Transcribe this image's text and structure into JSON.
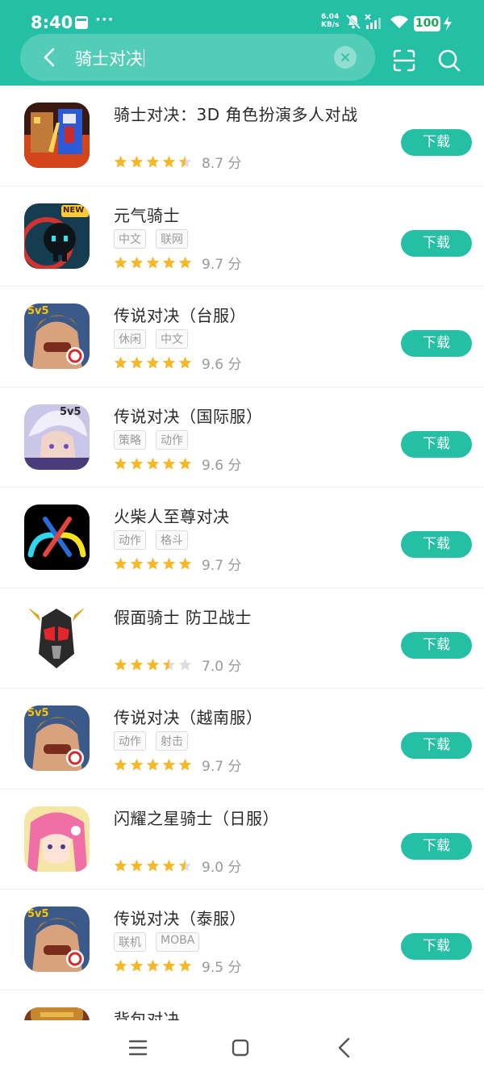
{
  "status_bar": {
    "time": "8:40",
    "dots": "···",
    "speed_value": "6.04",
    "speed_unit": "KB/s",
    "battery": "100"
  },
  "search": {
    "query": "骑士对决",
    "clear_label": "×"
  },
  "colors": {
    "accent": "#25bfa5",
    "star": "#f6b826",
    "star_empty": "#dddddd"
  },
  "apps": [
    {
      "name": "骑士对决：3D 角色扮演多人对战",
      "tags": [],
      "rating": 4.5,
      "score": "8.7 分",
      "button": "下载",
      "icon": "knight-duel-icon"
    },
    {
      "name": "元气骑士",
      "tags": [
        "中文",
        "联网"
      ],
      "rating": 5,
      "score": "9.7 分",
      "button": "下载",
      "icon": "soul-knight-icon",
      "badge": "NEW"
    },
    {
      "name": "传说对决（台服）",
      "tags": [
        "休闲",
        "中文"
      ],
      "rating": 5,
      "score": "9.6 分",
      "button": "下载",
      "icon": "aov-icon"
    },
    {
      "name": "传说对决（国际服）",
      "tags": [
        "策略",
        "动作"
      ],
      "rating": 5,
      "score": "9.6 分",
      "button": "下载",
      "icon": "aov-intl-icon"
    },
    {
      "name": "火柴人至尊对决",
      "tags": [
        "动作",
        "格斗"
      ],
      "rating": 5,
      "score": "9.7 分",
      "button": "下载",
      "icon": "stickman-icon"
    },
    {
      "name": "假面骑士 防卫战士",
      "tags": [],
      "rating": 3.5,
      "score": "7.0 分",
      "button": "下载",
      "icon": "kamen-rider-icon"
    },
    {
      "name": "传说对决（越南服）",
      "tags": [
        "动作",
        "射击"
      ],
      "rating": 5,
      "score": "9.7 分",
      "button": "下载",
      "icon": "aov-icon"
    },
    {
      "name": "闪耀之星骑士（日服）",
      "tags": [],
      "rating": 4.5,
      "score": "9.0 分",
      "button": "下载",
      "icon": "anime-girl-icon"
    },
    {
      "name": "传说对决（泰服）",
      "tags": [
        "联机",
        "MOBA"
      ],
      "rating": 5,
      "score": "9.5 分",
      "button": "下载",
      "icon": "aov-icon"
    },
    {
      "name": "背包对决",
      "tags": [],
      "rating": 0,
      "score": "",
      "button": "",
      "icon": "backpack-battle-icon"
    }
  ],
  "aov_badge": "5v5"
}
